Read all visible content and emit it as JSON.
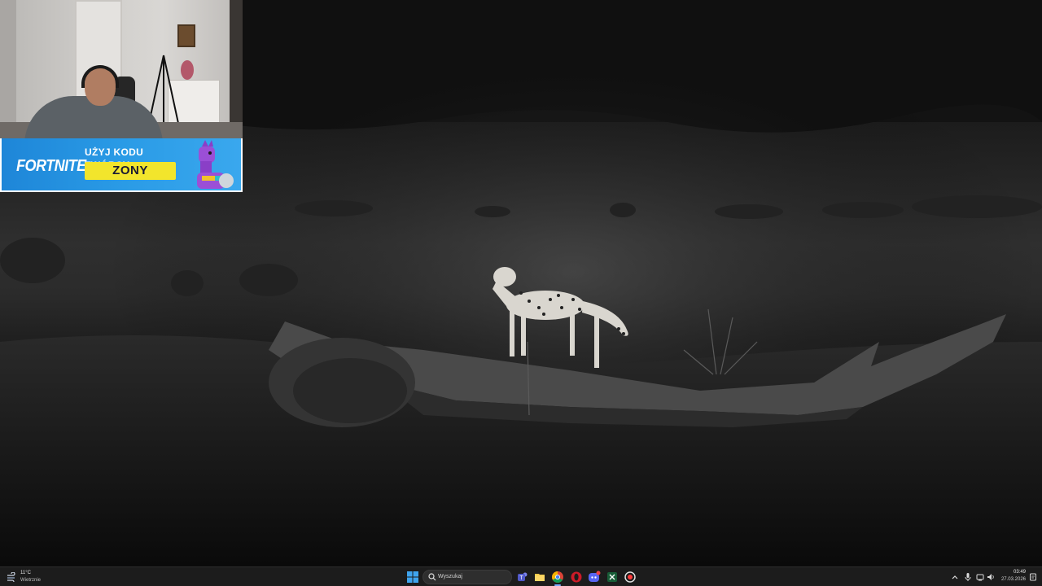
{
  "desktop": {
    "wallpaper_subject": "cheetah-on-log"
  },
  "overlay": {
    "banner": {
      "logo_text": "FORTNITE",
      "code_title": "UŻYJ KODU TWÓRCY",
      "code_value": "ZONY"
    }
  },
  "taskbar": {
    "weather": {
      "temperature": "11°C",
      "description": "Wietrznie"
    },
    "search": {
      "placeholder": "Wyszukaj"
    },
    "apps": [
      {
        "name": "teams-icon"
      },
      {
        "name": "file-explorer-icon"
      },
      {
        "name": "chrome-icon"
      },
      {
        "name": "opera-icon"
      },
      {
        "name": "discord-icon"
      },
      {
        "name": "excel-icon"
      },
      {
        "name": "recorder-icon"
      }
    ],
    "tray": {
      "time": "03:49",
      "date": "27.03.2026"
    }
  },
  "colors": {
    "taskbar_bg": "#1c1c1c",
    "banner_bg": "#2a9be6",
    "code_box": "#f2e52c"
  }
}
